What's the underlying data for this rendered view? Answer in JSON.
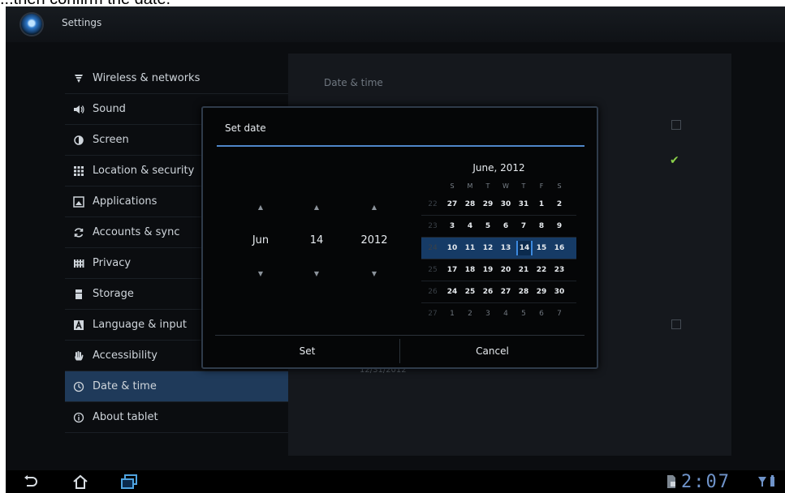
{
  "caption_fragment": "...then confirm the date.",
  "app": {
    "title": "Settings"
  },
  "sidebar": {
    "items": [
      {
        "label": "Wireless & networks",
        "icon": "wifi-icon"
      },
      {
        "label": "Sound",
        "icon": "speaker-icon"
      },
      {
        "label": "Screen",
        "icon": "brightness-icon"
      },
      {
        "label": "Location & security",
        "icon": "grid-icon"
      },
      {
        "label": "Applications",
        "icon": "applications-icon"
      },
      {
        "label": "Accounts & sync",
        "icon": "sync-icon"
      },
      {
        "label": "Privacy",
        "icon": "privacy-icon"
      },
      {
        "label": "Storage",
        "icon": "storage-icon"
      },
      {
        "label": "Language & input",
        "icon": "language-icon"
      },
      {
        "label": "Accessibility",
        "icon": "hand-icon"
      },
      {
        "label": "Date & time",
        "icon": "clock-icon",
        "active": true
      },
      {
        "label": "About tablet",
        "icon": "info-icon"
      }
    ]
  },
  "right_panel": {
    "header": "Date & time",
    "visible_date": "12/31/2012"
  },
  "dialog": {
    "title": "Set date",
    "month": "Jun",
    "day": "14",
    "year": "2012",
    "set_label": "Set",
    "cancel_label": "Cancel",
    "calendar": {
      "title": "June, 2012",
      "weekdays": [
        "S",
        "M",
        "T",
        "W",
        "T",
        "F",
        "S"
      ],
      "weeks": [
        {
          "num": "22",
          "days": [
            "27",
            "28",
            "29",
            "30",
            "31",
            "1",
            "2"
          ]
        },
        {
          "num": "23",
          "days": [
            "3",
            "4",
            "5",
            "6",
            "7",
            "8",
            "9"
          ]
        },
        {
          "num": "24",
          "days": [
            "10",
            "11",
            "12",
            "13",
            "14",
            "15",
            "16"
          ]
        },
        {
          "num": "25",
          "days": [
            "17",
            "18",
            "19",
            "20",
            "21",
            "22",
            "23"
          ]
        },
        {
          "num": "26",
          "days": [
            "24",
            "25",
            "26",
            "27",
            "28",
            "29",
            "30"
          ]
        },
        {
          "num": "27",
          "days": [
            "1",
            "2",
            "3",
            "4",
            "5",
            "6",
            "7"
          ]
        }
      ]
    }
  },
  "status": {
    "time": "2:07"
  },
  "colors": {
    "accent": "#4f86c8",
    "selection": "#163b66",
    "check": "#8bd14a"
  }
}
